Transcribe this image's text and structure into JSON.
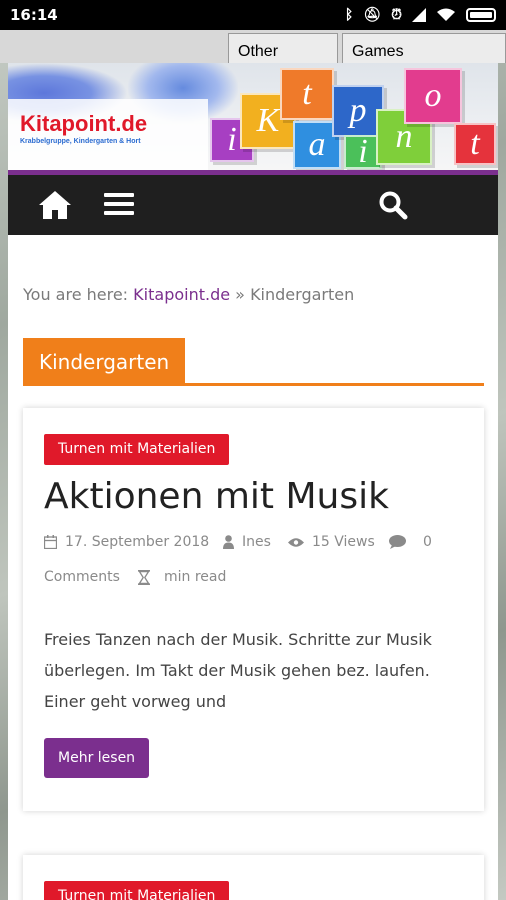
{
  "status_bar": {
    "time": "16:14"
  },
  "browser_tabs": [
    {
      "label": "Other"
    },
    {
      "label": "Games"
    }
  ],
  "site": {
    "name": "Kitapoint.de",
    "tagline": "Krabbelgruppe, Kindergarten & Hort",
    "cube_letters": [
      "K",
      "i",
      "t",
      "a",
      "p",
      "o",
      "i",
      "n",
      "t"
    ]
  },
  "breadcrumb": {
    "prefix": "You are here:",
    "home_link": "Kitapoint.de",
    "separator": "»",
    "current": "Kindergarten"
  },
  "category": {
    "title": "Kindergarten"
  },
  "posts": [
    {
      "tag": "Turnen mit Materialien",
      "title": "Aktionen mit Musik",
      "date": "17. September 2018",
      "author": "Ines",
      "views": "15 Views",
      "comments_count": "0",
      "comments_label": "Comments",
      "read_time": "min read",
      "excerpt": "Freies Tanzen nach der Musik. Schritte zur Musik überlegen. Im Takt der Musik gehen bez. laufen. Einer geht vorweg und",
      "more_label": "Mehr lesen"
    },
    {
      "tag": "Turnen mit Materialien"
    }
  ],
  "colors": {
    "accent_purple": "#7b2f8e",
    "accent_orange": "#f07f1a",
    "tag_red": "#e0192a",
    "nav_bg": "#1f1f1f"
  }
}
